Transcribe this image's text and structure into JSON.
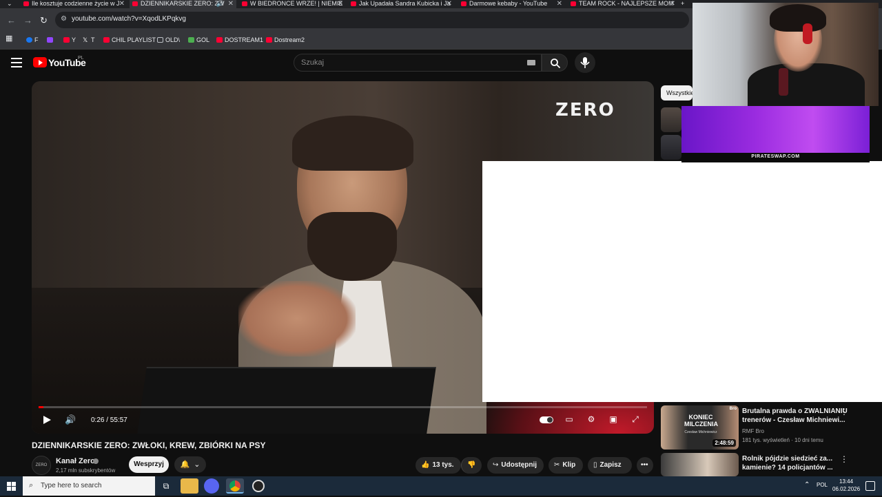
{
  "browser": {
    "tabs": [
      {
        "label": "Ile kosztuje codzienne życie w J"
      },
      {
        "label": "DZIENNIKARSKIE ZERO: ZW"
      },
      {
        "label": "W BIEDRONCE WRZE! | NIEMIE"
      },
      {
        "label": "Jak Upadała Sandra Kubicka i Ja"
      },
      {
        "label": "Darmowe kebaby - YouTube"
      },
      {
        "label": "TEAM ROCK - NAJLEPSZE MOM"
      }
    ],
    "url": "youtube.com/watch?v=XqodLKPqkvg",
    "bookmarks": [
      {
        "label": "F",
        "color": "#1877f2"
      },
      {
        "label": "",
        "color": "#9146ff"
      },
      {
        "label": "Y",
        "color": "#ff0033"
      },
      {
        "label": "T",
        "color": "#ffffff"
      },
      {
        "label": "CHIL PLAYLIST",
        "color": "#ff0033"
      },
      {
        "label": "OLD\\",
        "color": "#bdc1c6"
      },
      {
        "label": "GOL",
        "color": "#4caf50"
      },
      {
        "label": "DOSTREAM1",
        "color": "#ff0033"
      },
      {
        "label": "Dostream2",
        "color": "#ff0033"
      }
    ]
  },
  "youtube": {
    "logo_text": "YouTube",
    "region": "PL",
    "search_placeholder": "Szukaj",
    "video": {
      "brand_watermark": "ZERO",
      "time_current": "0:26",
      "time_total": "55:57",
      "time_display": "0:26 / 55:57",
      "progress_fraction": 0.008
    },
    "title": "DZIENNIKARSKIE ZERO: ZWŁOKI, KREW, ZBIÓRKI NA PSY",
    "channel": {
      "avatar_text": "ZERO",
      "name": "Kanał Zero",
      "subscribers": "2,17 mln subskrybentów"
    },
    "buttons": {
      "support": "Wesprzyj",
      "likes": "13 tys.",
      "share": "Udostępnij",
      "clip": "Klip",
      "save": "Zapisz"
    },
    "chip_all": "Wszystkie",
    "recommendations": [
      {
        "title": "Brutalna prawda o ZWALNIANIU trenerów - Czesław Michniewi...",
        "channel": "RMF Bro",
        "meta": "181 tys. wyświetleń · 10 dni temu",
        "duration": "2:48:59",
        "thumb_text": "KONIEC MILCZENIA",
        "thumb_subtext": "Czesław Michniewicz",
        "thumb_badge": "Bro"
      },
      {
        "title": "Rolnik pójdzie siedzieć za... kamienie? 14 policjantów ...",
        "channel": "",
        "meta": "",
        "duration": ""
      }
    ]
  },
  "overlay": {
    "sponsor_text": "PIRATESWAP.COM"
  },
  "taskbar": {
    "search_placeholder": "Type here to search",
    "language": "POL",
    "time": "13:44",
    "date": "06.02.2026"
  }
}
